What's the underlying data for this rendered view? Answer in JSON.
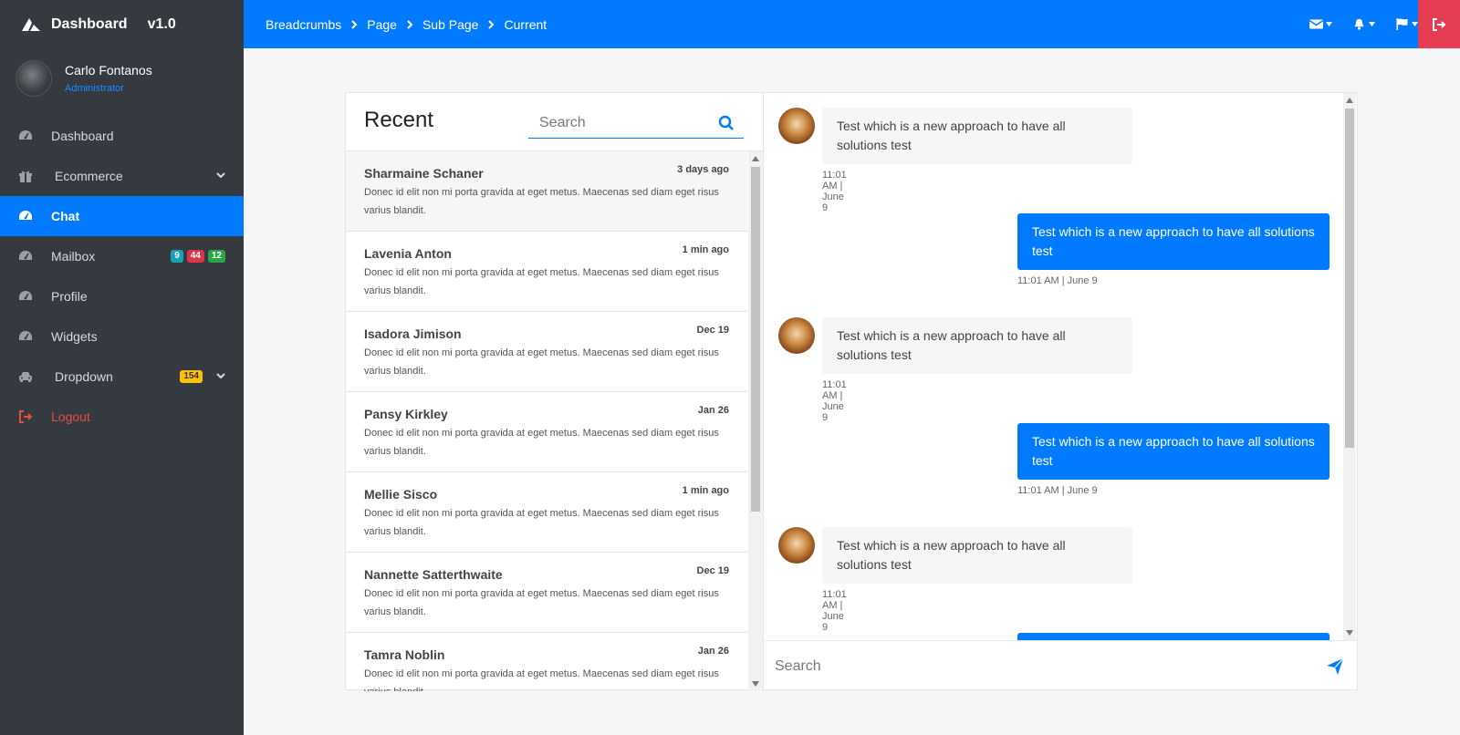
{
  "brand": {
    "title": "Dashboard",
    "version": "v1.0"
  },
  "user": {
    "name": "Carlo Fontanos",
    "role": "Administrator"
  },
  "sidebar": {
    "items": [
      {
        "label": "Dashboard",
        "icon": "dashboard-icon"
      },
      {
        "label": "Ecommerce",
        "icon": "gift-icon"
      },
      {
        "label": "Chat",
        "icon": "dashboard-icon"
      },
      {
        "label": "Mailbox",
        "icon": "dashboard-icon",
        "badges": [
          "9",
          "44",
          "12"
        ]
      },
      {
        "label": "Profile",
        "icon": "dashboard-icon"
      },
      {
        "label": "Widgets",
        "icon": "dashboard-icon"
      },
      {
        "label": "Dropdown",
        "icon": "car-icon",
        "badge": "154"
      },
      {
        "label": "Logout",
        "icon": "sign-out-icon"
      }
    ]
  },
  "breadcrumbs": [
    "Breadcrumbs",
    "Page",
    "Sub Page",
    "Current"
  ],
  "recent": {
    "title": "Recent",
    "search_placeholder": "Search",
    "conversations": [
      {
        "name": "Sharmaine Schaner",
        "time": "3 days ago",
        "text": "Donec id elit non mi porta gravida at eget metus. Maecenas sed diam eget risus varius blandit."
      },
      {
        "name": "Lavenia Anton",
        "time": "1 min ago",
        "text": "Donec id elit non mi porta gravida at eget metus. Maecenas sed diam eget risus varius blandit."
      },
      {
        "name": "Isadora Jimison",
        "time": "Dec 19",
        "text": "Donec id elit non mi porta gravida at eget metus. Maecenas sed diam eget risus varius blandit."
      },
      {
        "name": "Pansy Kirkley",
        "time": "Jan 26",
        "text": "Donec id elit non mi porta gravida at eget metus. Maecenas sed diam eget risus varius blandit."
      },
      {
        "name": "Mellie Sisco",
        "time": "1 min ago",
        "text": "Donec id elit non mi porta gravida at eget metus. Maecenas sed diam eget risus varius blandit."
      },
      {
        "name": "Nannette Satterthwaite",
        "time": "Dec 19",
        "text": "Donec id elit non mi porta gravida at eget metus. Maecenas sed diam eget risus varius blandit."
      },
      {
        "name": "Tamra Noblin",
        "time": "Jan 26",
        "text": "Donec id elit non mi porta gravida at eget metus. Maecenas sed diam eget risus varius blandit."
      }
    ]
  },
  "messages": [
    {
      "direction": "in",
      "text": "Test which is a new approach to have all solutions test",
      "time": "11:01 AM | June 9"
    },
    {
      "direction": "out",
      "text": "Test which is a new approach to have all solutions test",
      "time": "11:01 AM | June 9"
    },
    {
      "direction": "in",
      "text": "Test which is a new approach to have all solutions test",
      "time": "11:01 AM | June 9"
    },
    {
      "direction": "out",
      "text": "Test which is a new approach to have all solutions test",
      "time": "11:01 AM | June 9"
    },
    {
      "direction": "in",
      "text": "Test which is a new approach to have all solutions test",
      "time": "11:01 AM | June 9"
    }
  ],
  "composer": {
    "placeholder": "Search"
  },
  "colors": {
    "primary": "#007bff",
    "sidebar": "#343a40",
    "logout": "#e53e52",
    "danger": "#dc3545"
  }
}
